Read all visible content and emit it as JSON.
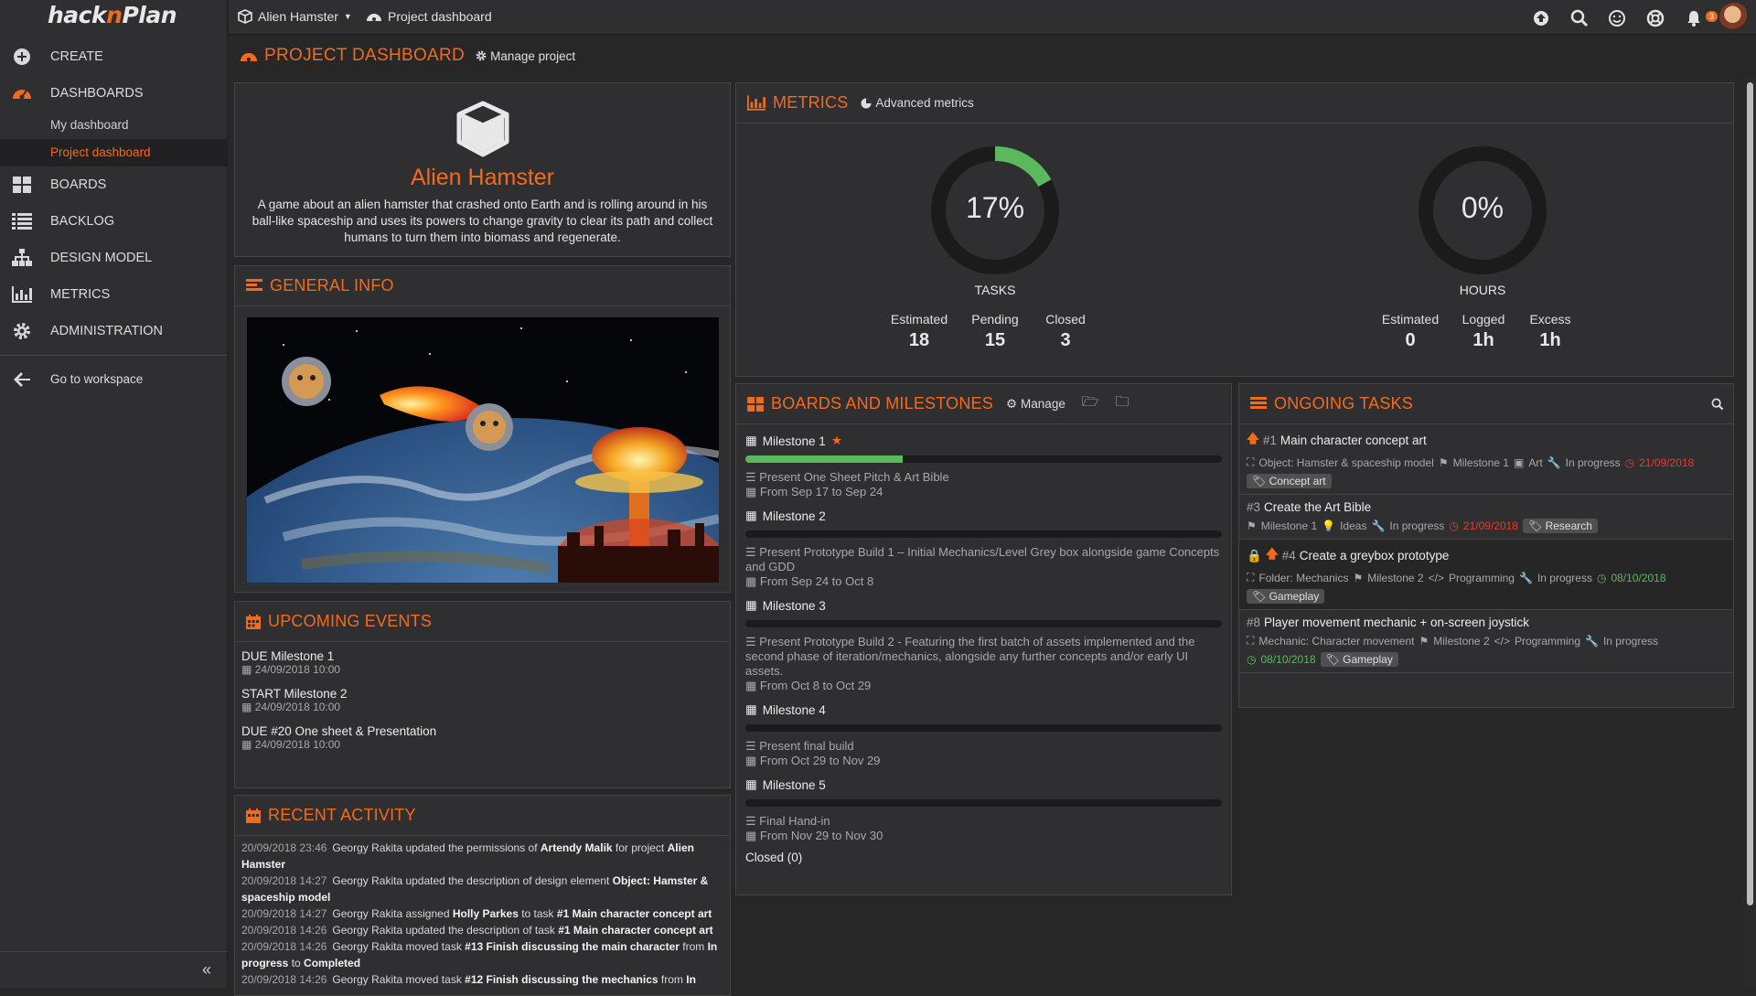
{
  "app": {
    "logo_left": "hack",
    "logo_n": "n",
    "logo_right": "Plan"
  },
  "sidebar": {
    "items": [
      {
        "label": "CREATE",
        "icon": "plus-circle-icon"
      },
      {
        "label": "DASHBOARDS",
        "icon": "dashboard-icon"
      },
      {
        "label": "My dashboard"
      },
      {
        "label": "Project dashboard"
      },
      {
        "label": "BOARDS",
        "icon": "boards-icon"
      },
      {
        "label": "BACKLOG",
        "icon": "list-icon"
      },
      {
        "label": "DESIGN MODEL",
        "icon": "sitemap-icon"
      },
      {
        "label": "METRICS",
        "icon": "bar-chart-icon"
      },
      {
        "label": "ADMINISTRATION",
        "icon": "gear-icon"
      },
      {
        "label": "Go to workspace",
        "icon": "arrow-left-icon"
      }
    ],
    "collapse_label": "«"
  },
  "topbar": {
    "project": "Alien Hamster",
    "dashboard": "Project dashboard",
    "notification_count": "3"
  },
  "page": {
    "title": "PROJECT DASHBOARD",
    "manage": "Manage project"
  },
  "project": {
    "name": "Alien Hamster",
    "description": "A game about an alien hamster that crashed onto Earth and is rolling around in his ball-like spaceship and uses its powers to change gravity to clear its path and collect humans to turn them into biomass and regenerate."
  },
  "general_info": {
    "title": "GENERAL INFO"
  },
  "upcoming": {
    "title": "UPCOMING EVENTS",
    "events": [
      {
        "name": "DUE Milestone 1",
        "date": "24/09/2018 10:00"
      },
      {
        "name": "START Milestone 2",
        "date": "24/09/2018 10:00"
      },
      {
        "name": "DUE #20 One sheet & Presentation",
        "date": "24/09/2018 10:00"
      }
    ]
  },
  "activity": {
    "title": "RECENT ACTIVITY",
    "items": [
      {
        "ts": "20/09/2018 23:46",
        "text": "Georgy Rakita updated the permissions of ",
        "b1": "Artendy Malik",
        "mid": " for project ",
        "b2": "Alien Hamster",
        "tail": ""
      },
      {
        "ts": "20/09/2018 14:27",
        "text": "Georgy Rakita updated the description of design element ",
        "b1": "Object: Hamster & spaceship model",
        "mid": "",
        "b2": "",
        "tail": ""
      },
      {
        "ts": "20/09/2018 14:27",
        "text": "Georgy Rakita assigned ",
        "b1": "Holly Parkes",
        "mid": " to task ",
        "b2": "#1 Main character concept art",
        "tail": ""
      },
      {
        "ts": "20/09/2018 14:26",
        "text": "Georgy Rakita updated the description of task ",
        "b1": "#1 Main character concept art",
        "mid": "",
        "b2": "",
        "tail": ""
      },
      {
        "ts": "20/09/2018 14:26",
        "text": "Georgy Rakita moved task ",
        "b1": "#13 Finish discussing the main character",
        "mid": " from ",
        "b2": "In progress",
        "tail": " to ",
        "b3": "Completed"
      },
      {
        "ts": "20/09/2018 14:26",
        "text": "Georgy Rakita moved task ",
        "b1": "#12 Finish discussing the mechanics",
        "mid": " from ",
        "b2": "In",
        "tail": ""
      }
    ]
  },
  "metrics": {
    "title": "METRICS",
    "advanced": "Advanced metrics",
    "tasks": {
      "pct": "17%",
      "fraction": 0.17,
      "label": "TASKS",
      "estimated_label": "Estimated",
      "estimated": "18",
      "pending_label": "Pending",
      "pending": "15",
      "closed_label": "Closed",
      "closed": "3"
    },
    "hours": {
      "pct": "0%",
      "fraction": 0,
      "label": "HOURS",
      "estimated_label": "Estimated",
      "estimated": "0",
      "logged_label": "Logged",
      "logged": "1h",
      "excess_label": "Excess",
      "excess": "1h"
    }
  },
  "boards": {
    "title": "BOARDS AND MILESTONES",
    "manage": "Manage",
    "milestones": [
      {
        "name": "Milestone 1",
        "progress": 0.33,
        "desc": "Present One Sheet Pitch & Art Bible",
        "dates": "From Sep 17 to Sep 24"
      },
      {
        "name": "Milestone 2",
        "progress": 0,
        "desc": "Present Prototype Build 1 – Initial Mechanics/Level Grey box alongside game Concepts and GDD",
        "dates": "From Sep 24 to Oct 8"
      },
      {
        "name": "Milestone 3",
        "progress": 0,
        "desc": "Present Prototype Build 2 - Featuring the first batch of assets implemented and the second phase of iteration/mechanics, alongside any further concepts and/or early UI assets.",
        "dates": "From Oct 8 to Oct 29"
      },
      {
        "name": "Milestone 4",
        "progress": 0,
        "desc": "Present final build",
        "dates": "From Oct 29 to Nov 29"
      },
      {
        "name": "Milestone 5",
        "progress": 0,
        "desc": "Final Hand-in",
        "dates": "From Nov 29 to Nov 30"
      }
    ],
    "closed": "Closed (0)"
  },
  "ongoing": {
    "title": "ONGOING TASKS",
    "tasks": [
      {
        "id": "#1",
        "name": "Main character concept art",
        "meta1": "Object: Hamster & spaceship model",
        "milestone": "Milestone 1",
        "category": "Art",
        "status": "In progress",
        "date": "21/09/2018",
        "tag": "Concept art"
      },
      {
        "id": "#3",
        "name": "Create the Art Bible",
        "milestone": "Milestone 1",
        "category": "Ideas",
        "status": "In progress",
        "date": "21/09/2018",
        "tag": "Research"
      },
      {
        "id": "#4",
        "name": "Create a greybox prototype",
        "meta1": "Folder: Mechanics",
        "milestone": "Milestone 2",
        "category": "Programming",
        "status": "In progress",
        "date": "08/10/2018",
        "tag": "Gameplay"
      },
      {
        "id": "#8",
        "name": "Player movement mechanic + on-screen joystick",
        "meta1": "Mechanic: Character movement",
        "milestone": "Milestone 2",
        "category": "Programming",
        "status": "In progress",
        "date": "08/10/2018",
        "tag": "Gameplay"
      }
    ]
  },
  "colors": {
    "accent": "#f26b1d",
    "progress": "#5cb85c",
    "overdue": "#e03e2d",
    "ok": "#5cb85c"
  }
}
